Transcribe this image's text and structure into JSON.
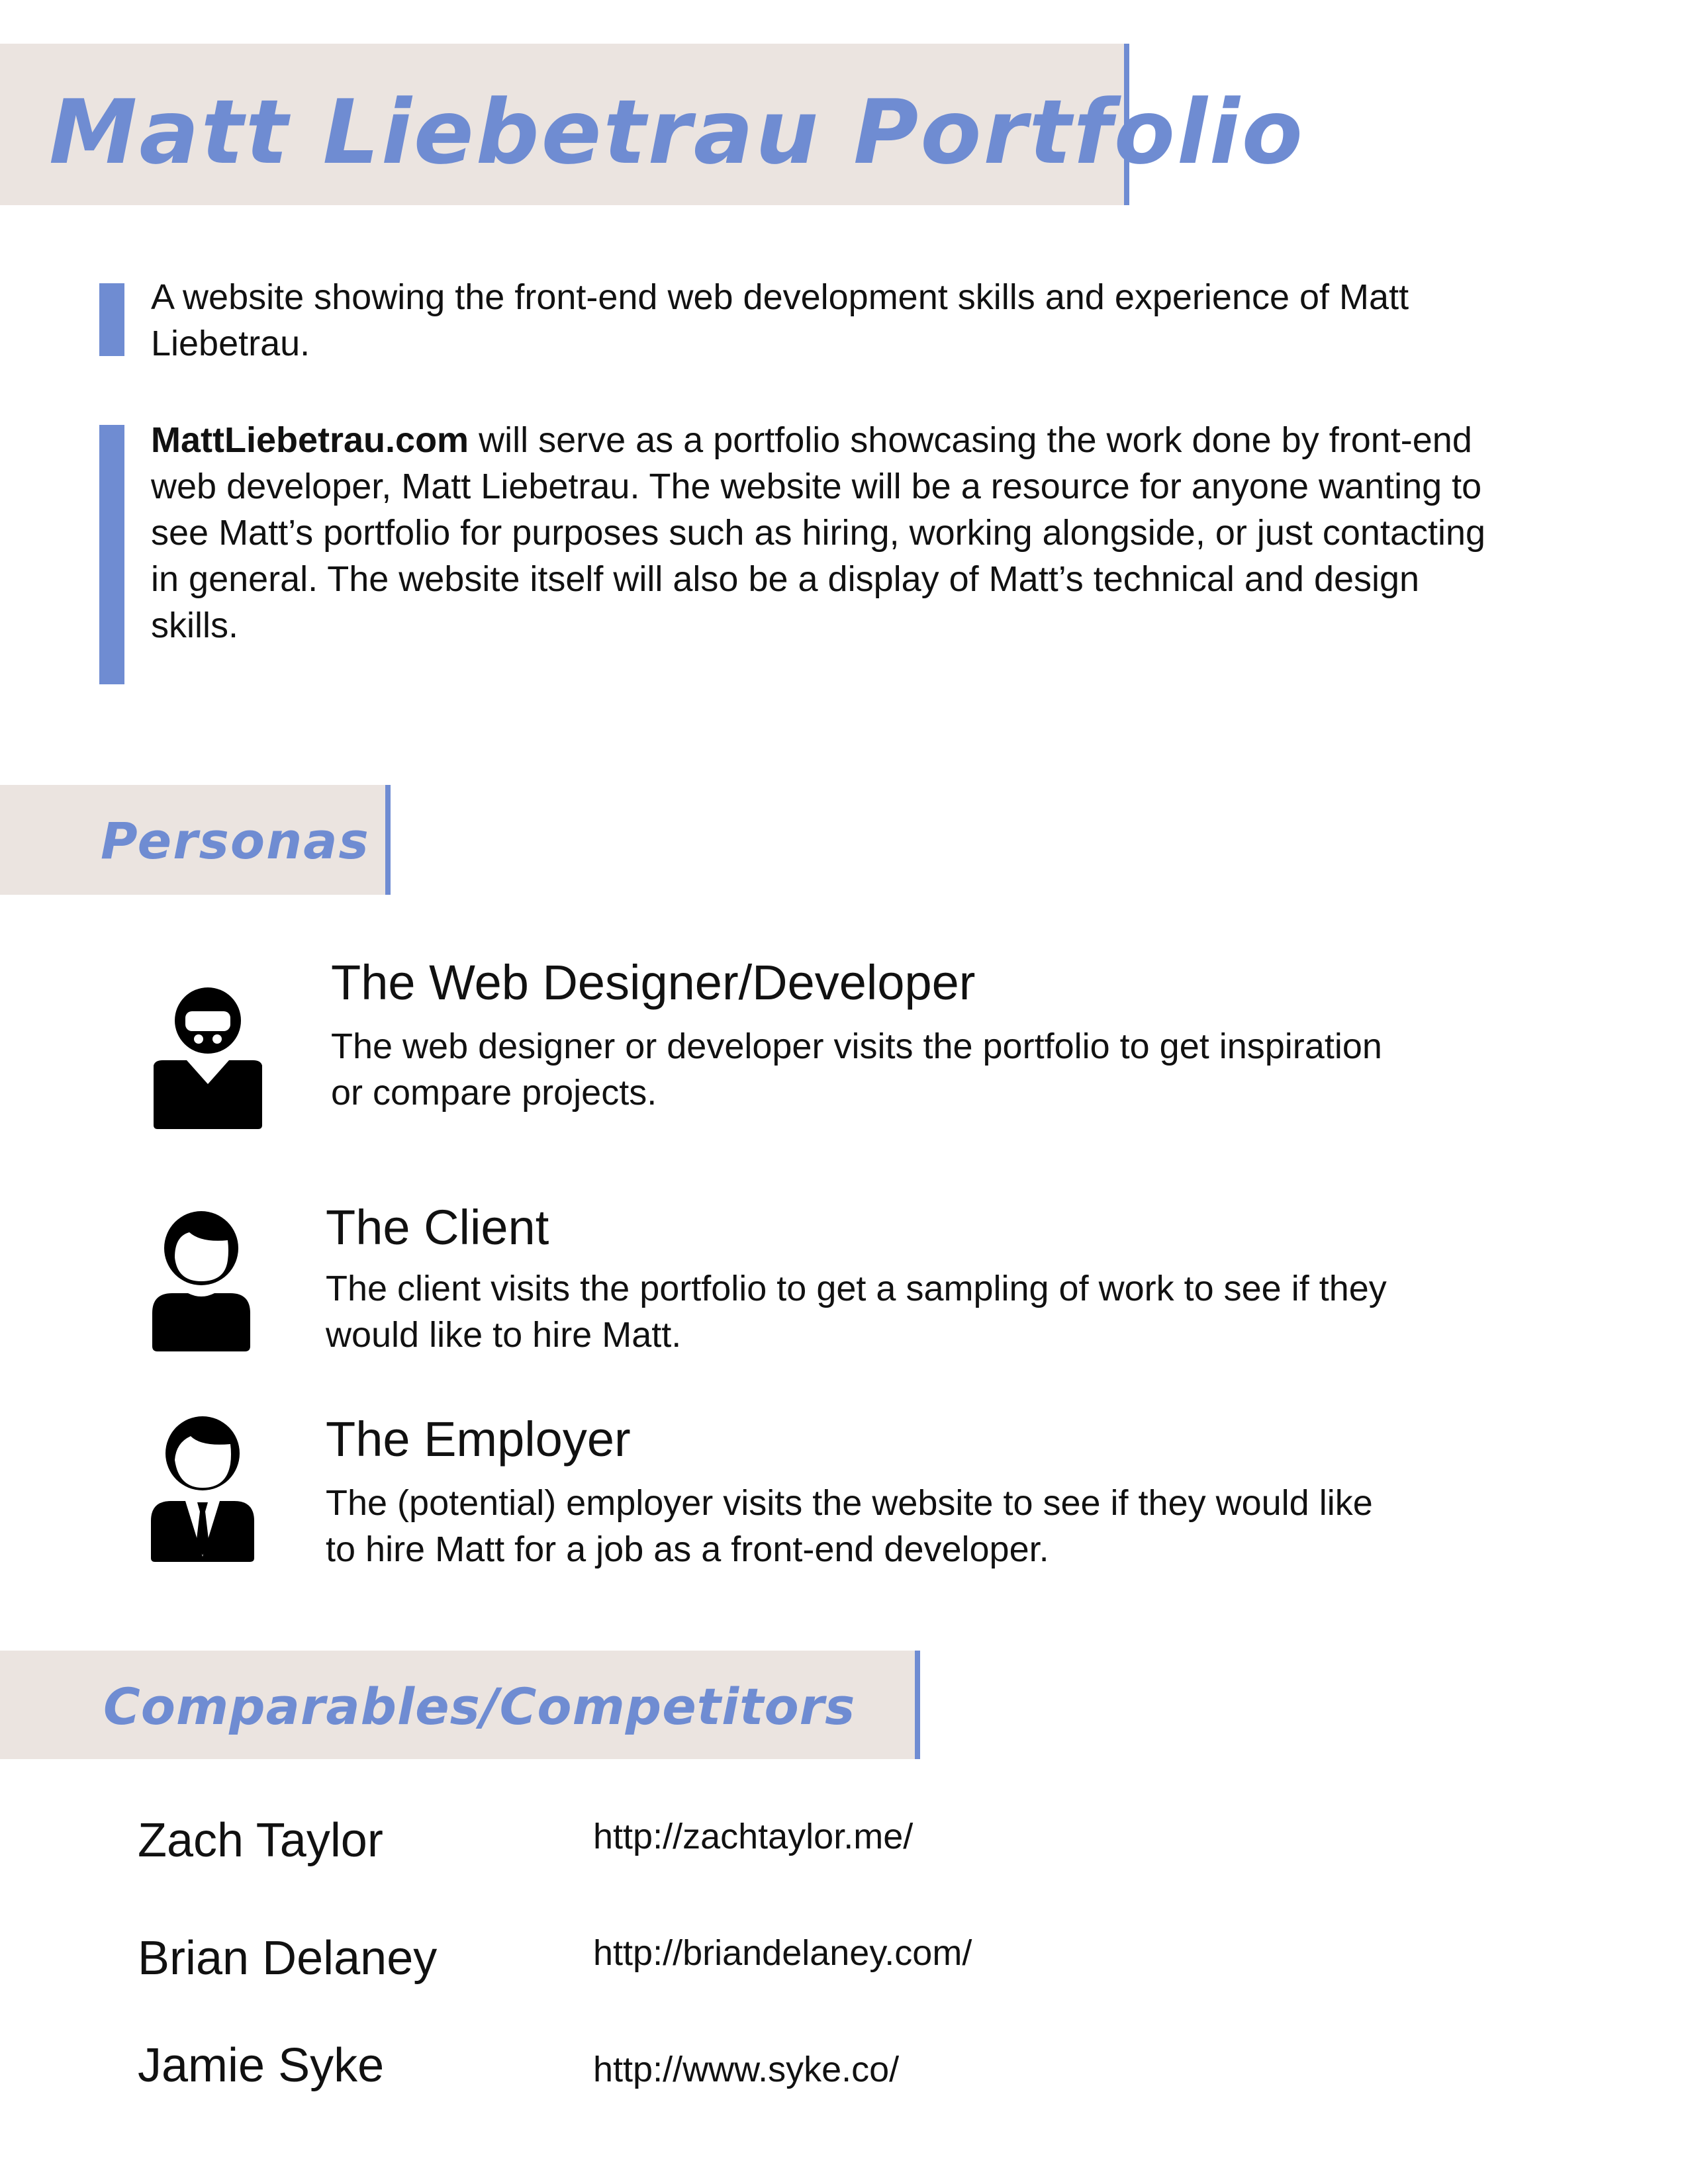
{
  "header": {
    "title": "Matt Liebetrau Portfolio"
  },
  "intro": {
    "summary": "A website showing the front-end web development skills and experience of Matt Liebetrau.",
    "site_name": "MattLiebetrau.com",
    "description": " will serve as a portfolio showcasing the work done by front-end web developer, Matt Liebetrau. The website will be a resource for anyone wanting to see Matt’s portfolio for purposes such as hiring, working alongside, or just contacting in general. The website itself will also be a display of Matt’s technical and design skills."
  },
  "personas": {
    "heading": "Personas",
    "items": [
      {
        "name": "The Web Designer/Developer",
        "description": "The web designer or developer visits the portfolio to get inspiration or compare projects.",
        "icon": "bearded-person-icon"
      },
      {
        "name": "The Client",
        "description": "The client visits the portfolio to get a sampling of work to see if they would like to hire Matt.",
        "icon": "person-icon"
      },
      {
        "name": "The Employer",
        "description": "The (potential) employer visits the website to see if they would like to hire Matt for a job as a front-end developer.",
        "icon": "businessman-icon"
      }
    ]
  },
  "comparables": {
    "heading": "Comparables/Competitors",
    "items": [
      {
        "name": "Zach Taylor",
        "url": "http://zachtaylor.me/"
      },
      {
        "name": "Brian Delaney",
        "url": "http://briandelaney.com/"
      },
      {
        "name": "Jamie Syke",
        "url": "http://www.syke.co/"
      }
    ]
  },
  "colors": {
    "accent": "#6f8cd2",
    "band": "#ebe4e0",
    "text": "#111111"
  }
}
